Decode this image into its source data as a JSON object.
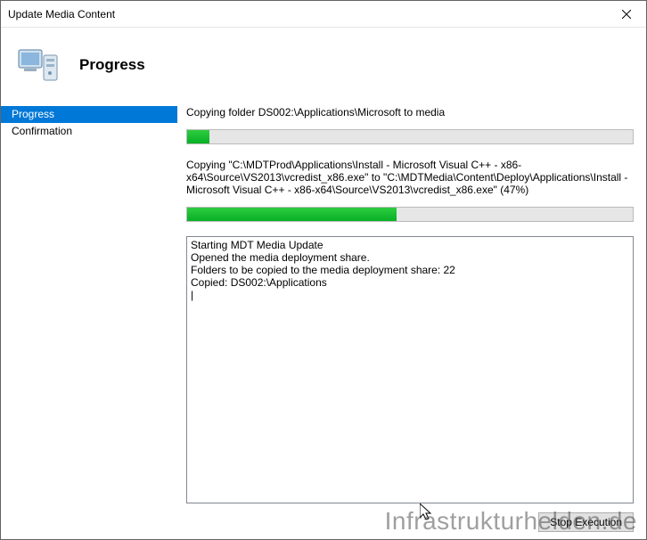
{
  "window": {
    "title": "Update Media Content"
  },
  "header": {
    "heading": "Progress"
  },
  "sidebar": {
    "items": [
      {
        "label": "Progress",
        "selected": true
      },
      {
        "label": "Confirmation",
        "selected": false
      }
    ]
  },
  "progress": {
    "status1": "Copying folder DS002:\\Applications\\Microsoft to media",
    "bar1_percent": 5,
    "status2": "Copying \"C:\\MDTProd\\Applications\\Install - Microsoft Visual C++ - x86-x64\\Source\\VS2013\\vcredist_x86.exe\" to \"C:\\MDTMedia\\Content\\Deploy\\Applications\\Install - Microsoft Visual C++ - x86-x64\\Source\\VS2013\\vcredist_x86.exe\" (47%)",
    "bar2_percent": 47,
    "log": "Starting MDT Media Update\nOpened the media deployment share.\nFolders to be copied to the media deployment share: 22\nCopied: DS002:\\Applications\n|",
    "stop_label": "Stop Execution"
  },
  "watermark": "Infrastrukturhelden.de"
}
